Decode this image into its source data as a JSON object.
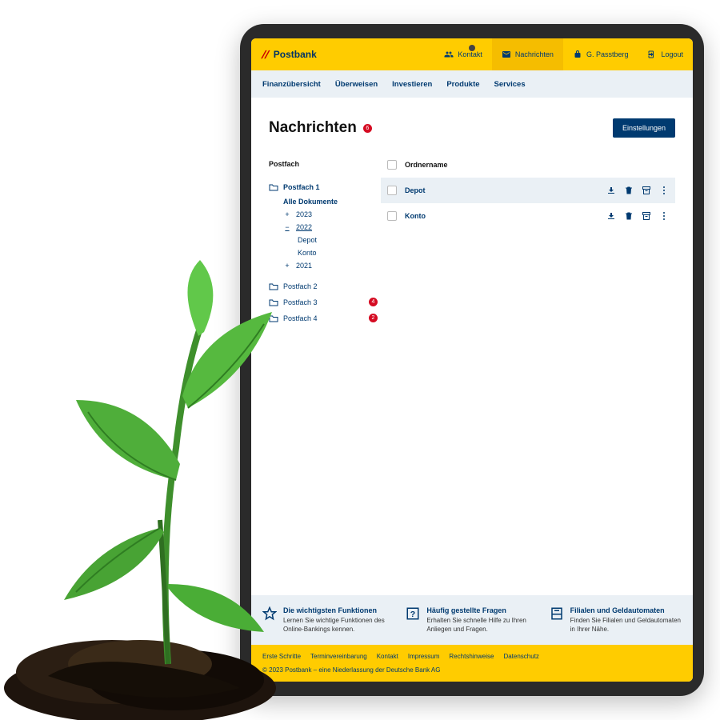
{
  "brand": "Postbank",
  "header": {
    "kontakt": "Kontakt",
    "nachrichten": "Nachrichten",
    "user": "G. Passtberg",
    "logout": "Logout"
  },
  "nav": [
    "Finanzübersicht",
    "Überweisen",
    "Investieren",
    "Produkte",
    "Services"
  ],
  "page": {
    "title": "Nachrichten",
    "count": "6",
    "settings": "Einstellungen"
  },
  "side": {
    "header": "Postfach",
    "box1": "Postfach 1",
    "all": "Alle Dokumente",
    "y2023": "2023",
    "y2022": "2022",
    "y2021": "2021",
    "depot": "Depot",
    "konto": "Konto",
    "box2": "Postfach 2",
    "box3": "Postfach 3",
    "box3_badge": "4",
    "box4": "Postfach 4",
    "box4_badge": "2"
  },
  "table": {
    "col": "Ordnername",
    "rows": [
      {
        "name": "Depot",
        "selected": true
      },
      {
        "name": "Konto",
        "selected": false
      }
    ]
  },
  "tiles": [
    {
      "title": "Die wichtigsten Funktionen",
      "text": "Lernen Sie wichtige Funktionen des Online-Bankings kennen."
    },
    {
      "title": "Häufig gestellte Fragen",
      "text": "Erhalten Sie schnelle Hilfe zu Ihren Anliegen und Fragen."
    },
    {
      "title": "Filialen und Geldautomaten",
      "text": "Finden Sie Filialen und Geldautomaten in Ihrer Nähe."
    }
  ],
  "footer": {
    "links": [
      "Erste Schritte",
      "Terminvereinbarung",
      "Kontakt",
      "Impressum",
      "Rechtshinweise",
      "Datenschutz"
    ],
    "copy": "© 2023 Postbank – eine Niederlassung der Deutsche Bank AG"
  }
}
